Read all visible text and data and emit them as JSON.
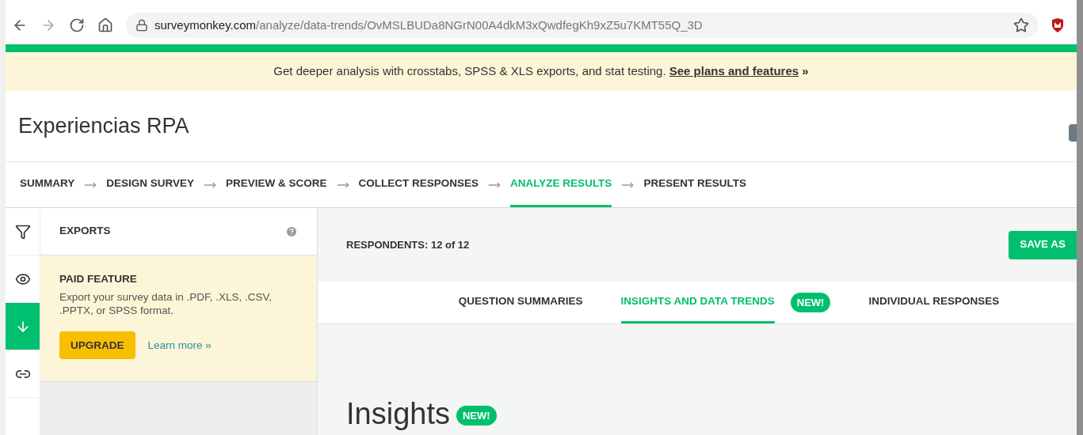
{
  "browser": {
    "url_host": "surveymonkey.com",
    "url_path": "/analyze/data-trends/OvMSLBUDa8NGrN00A4dkM3xQwdfegKh9xZ5u7KMT55Q_3D"
  },
  "banner": {
    "text": "Get deeper analysis with crosstabs, SPSS & XLS exports, and stat testing.",
    "link": "See plans and features",
    "suffix": "»"
  },
  "survey_title": "Experiencias RPA",
  "steps": [
    {
      "label": "SUMMARY",
      "selected": false
    },
    {
      "label": "DESIGN SURVEY",
      "selected": false
    },
    {
      "label": "PREVIEW & SCORE",
      "selected": false
    },
    {
      "label": "COLLECT RESPONSES",
      "selected": false
    },
    {
      "label": "ANALYZE RESULTS",
      "selected": true
    },
    {
      "label": "PRESENT RESULTS",
      "selected": false
    }
  ],
  "rail": [
    {
      "kind": "filter",
      "selected": false
    },
    {
      "kind": "eye",
      "selected": false
    },
    {
      "kind": "download",
      "selected": true
    },
    {
      "kind": "link",
      "selected": false
    }
  ],
  "panel": {
    "title": "EXPORTS",
    "paid_title": "PAID FEATURE",
    "paid_text": "Export your survey data in .PDF, .XLS, .CSV, .PPTX, or SPSS format.",
    "upgrade": "UPGRADE",
    "learn_more": "Learn more »"
  },
  "respondents": "RESPONDENTS: 12 of 12",
  "save_as": "SAVE AS",
  "tabs": [
    {
      "label": "QUESTION SUMMARIES",
      "selected": false
    },
    {
      "label": "INSIGHTS AND DATA TRENDS",
      "selected": true,
      "badge": "NEW!"
    },
    {
      "label": "INDIVIDUAL RESPONSES",
      "selected": false
    }
  ],
  "insights": {
    "title": "Insights",
    "badge": "NEW!"
  }
}
